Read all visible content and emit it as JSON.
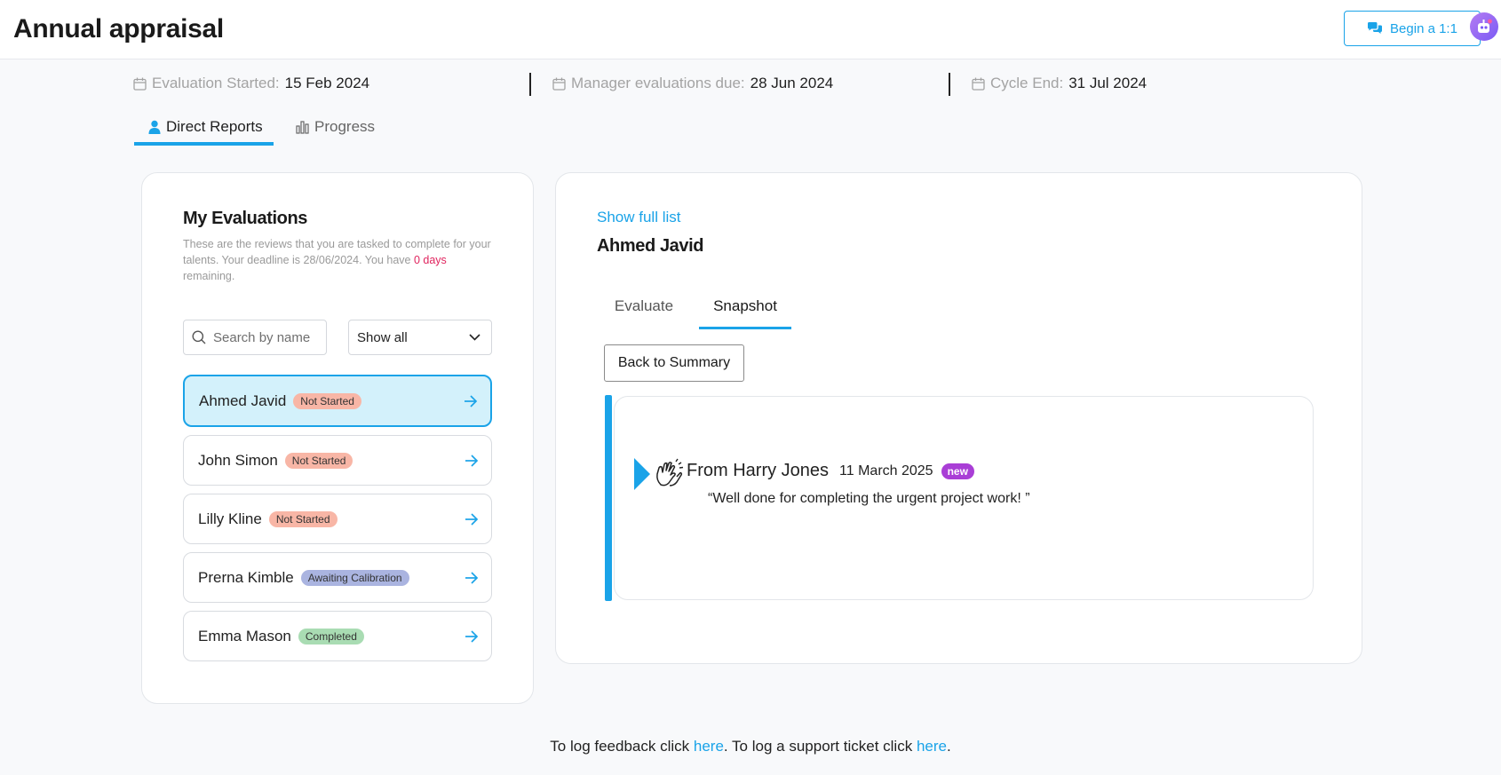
{
  "header": {
    "title": "Annual appraisal",
    "begin_button_label": "Begin a 1:1"
  },
  "dates": {
    "started_label": "Evaluation Started:",
    "started_value": "15 Feb 2024",
    "due_label": "Manager evaluations due:",
    "due_value": "28 Jun 2024",
    "end_label": "Cycle End:",
    "end_value": "31 Jul 2024"
  },
  "main_tabs": {
    "direct_reports": "Direct Reports",
    "progress": "Progress"
  },
  "evaluations": {
    "title": "My Evaluations",
    "desc_before": "These are the reviews that you are tasked to complete for your talents. Your deadline is 28/06/2024. You have ",
    "desc_highlight": "0 days",
    "desc_after": " remaining.",
    "search_placeholder": "Search by name",
    "filter_value": "Show all",
    "items": [
      {
        "name": "Ahmed Javid",
        "status": "Not Started"
      },
      {
        "name": "John Simon",
        "status": "Not Started"
      },
      {
        "name": "Lilly Kline",
        "status": "Not Started"
      },
      {
        "name": "Prerna Kimble",
        "status": "Awaiting Calibration"
      },
      {
        "name": "Emma Mason",
        "status": "Completed"
      }
    ]
  },
  "detail": {
    "show_full_list": "Show full list",
    "person_name": "Ahmed Javid",
    "tabs": {
      "evaluate": "Evaluate",
      "snapshot": "Snapshot"
    },
    "back_button": "Back to Summary",
    "snapshot": {
      "from": "From Harry Jones",
      "date": "11 March 2025",
      "badge": "new",
      "quote": "“Well done for completing the urgent project work! ”"
    }
  },
  "footer": {
    "part1": "To log feedback click ",
    "link1": "here",
    "part2": ". To log a support ticket click ",
    "link2": "here",
    "part3": "."
  },
  "colors": {
    "accent": "#1aa3e8",
    "not_started": "#f8b6a6",
    "awaiting": "#aab4e0",
    "completed": "#a9dcb3",
    "new_badge": "#a93ed6",
    "deadline_red": "#e0245e"
  }
}
